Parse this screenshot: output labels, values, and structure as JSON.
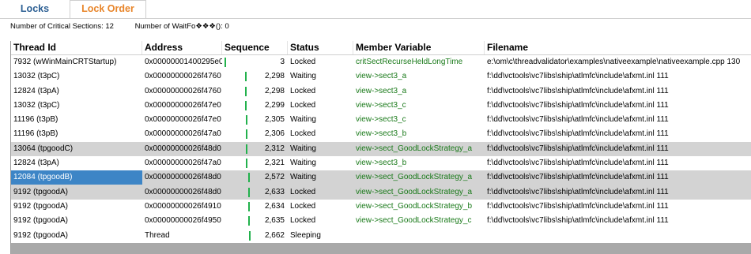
{
  "tabs": [
    {
      "label": "Locks",
      "active": false
    },
    {
      "label": "Lock Order",
      "active": true
    }
  ],
  "stats": {
    "critical_sections": "Number of Critical Sections: 12",
    "waitfor": "Number of WaitFo❖❖❖(): 0"
  },
  "columns": [
    "Thread Id",
    "Address",
    "Sequence",
    "Status",
    "Member Variable",
    "Filename"
  ],
  "colors": {
    "accent_tab": "#e8852a",
    "inactive_tab": "#2c5f93",
    "selection": "#3d85c6",
    "member_text": "#1a7a1a",
    "sequence_bar": "#22b14c",
    "highlight_row": "#d3d3d3"
  },
  "rows": [
    {
      "thread": "7932 (wWinMainCRTStartup)",
      "address": "0x00000001400295e0",
      "sequence": "3",
      "status": "Locked",
      "member": "critSectRecurseHeldLongTime",
      "filename": "e:\\om\\c\\threadvalidator\\examples\\nativeexample\\nativeexample.cpp 130",
      "bar": 0.02,
      "gray": false,
      "selected": false
    },
    {
      "thread": "13032 (t3pC)",
      "address": "0x00000000026f4760",
      "sequence": "2,298",
      "status": "Waiting",
      "member": "view->sect3_a",
      "filename": "f:\\dd\\vctools\\vc7libs\\ship\\atlmfc\\include\\afxmt.inl 111",
      "bar": 0.45,
      "gray": false,
      "selected": false
    },
    {
      "thread": "12824 (t3pA)",
      "address": "0x00000000026f4760",
      "sequence": "2,298",
      "status": "Locked",
      "member": "view->sect3_a",
      "filename": "f:\\dd\\vctools\\vc7libs\\ship\\atlmfc\\include\\afxmt.inl 111",
      "bar": 0.45,
      "gray": false,
      "selected": false
    },
    {
      "thread": "13032 (t3pC)",
      "address": "0x00000000026f47e0",
      "sequence": "2,299",
      "status": "Locked",
      "member": "view->sect3_c",
      "filename": "f:\\dd\\vctools\\vc7libs\\ship\\atlmfc\\include\\afxmt.inl 111",
      "bar": 0.45,
      "gray": false,
      "selected": false
    },
    {
      "thread": "11196 (t3pB)",
      "address": "0x00000000026f47e0",
      "sequence": "2,305",
      "status": "Waiting",
      "member": "view->sect3_c",
      "filename": "f:\\dd\\vctools\\vc7libs\\ship\\atlmfc\\include\\afxmt.inl 111",
      "bar": 0.46,
      "gray": false,
      "selected": false
    },
    {
      "thread": "11196 (t3pB)",
      "address": "0x00000000026f47a0",
      "sequence": "2,306",
      "status": "Locked",
      "member": "view->sect3_b",
      "filename": "f:\\dd\\vctools\\vc7libs\\ship\\atlmfc\\include\\afxmt.inl 111",
      "bar": 0.46,
      "gray": false,
      "selected": false
    },
    {
      "thread": "13064 (tpgoodC)",
      "address": "0x00000000026f48d0",
      "sequence": "2,312",
      "status": "Waiting",
      "member": "view->sect_GoodLockStrategy_a",
      "filename": "f:\\dd\\vctools\\vc7libs\\ship\\atlmfc\\include\\afxmt.inl 111",
      "bar": 0.46,
      "gray": true,
      "selected": false
    },
    {
      "thread": "12824 (t3pA)",
      "address": "0x00000000026f47a0",
      "sequence": "2,321",
      "status": "Waiting",
      "member": "view->sect3_b",
      "filename": "f:\\dd\\vctools\\vc7libs\\ship\\atlmfc\\include\\afxmt.inl 111",
      "bar": 0.46,
      "gray": false,
      "selected": false
    },
    {
      "thread": "12084 (tpgoodB)",
      "address": "0x00000000026f48d0",
      "sequence": "2,572",
      "status": "Waiting",
      "member": "view->sect_GoodLockStrategy_a",
      "filename": "f:\\dd\\vctools\\vc7libs\\ship\\atlmfc\\include\\afxmt.inl 111",
      "bar": 0.51,
      "gray": true,
      "selected": true
    },
    {
      "thread": "9192 (tpgoodA)",
      "address": "0x00000000026f48d0",
      "sequence": "2,633",
      "status": "Locked",
      "member": "view->sect_GoodLockStrategy_a",
      "filename": "f:\\dd\\vctools\\vc7libs\\ship\\atlmfc\\include\\afxmt.inl 111",
      "bar": 0.52,
      "gray": true,
      "selected": false
    },
    {
      "thread": "9192 (tpgoodA)",
      "address": "0x00000000026f4910",
      "sequence": "2,634",
      "status": "Locked",
      "member": "view->sect_GoodLockStrategy_b",
      "filename": "f:\\dd\\vctools\\vc7libs\\ship\\atlmfc\\include\\afxmt.inl 111",
      "bar": 0.52,
      "gray": false,
      "selected": false
    },
    {
      "thread": "9192 (tpgoodA)",
      "address": "0x00000000026f4950",
      "sequence": "2,635",
      "status": "Locked",
      "member": "view->sect_GoodLockStrategy_c",
      "filename": "f:\\dd\\vctools\\vc7libs\\ship\\atlmfc\\include\\afxmt.inl 111",
      "bar": 0.52,
      "gray": false,
      "selected": false
    },
    {
      "thread": "9192 (tpgoodA)",
      "address": "Thread",
      "sequence": "2,662",
      "status": "Sleeping",
      "member": "",
      "filename": "",
      "bar": 0.53,
      "gray": false,
      "selected": false
    }
  ]
}
